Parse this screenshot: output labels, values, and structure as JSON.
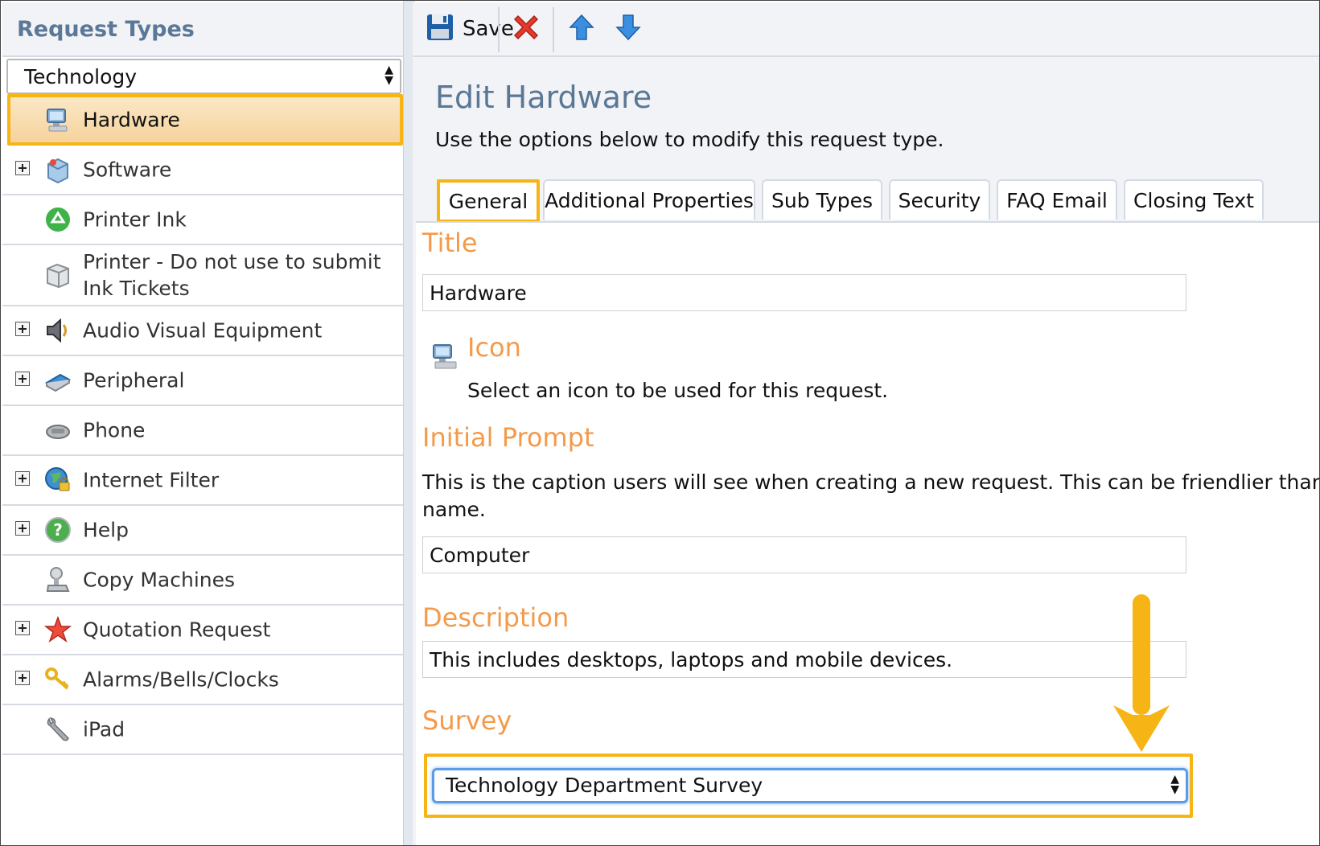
{
  "sidebar": {
    "title": "Request Types",
    "category": "Technology",
    "items": [
      {
        "label": "Hardware",
        "icon": "computer-icon",
        "expandable": false,
        "selected": true
      },
      {
        "label": "Software",
        "icon": "software-box-icon",
        "expandable": true
      },
      {
        "label": "Printer Ink",
        "icon": "recycle-icon",
        "expandable": false
      },
      {
        "label": "Printer - Do not use to submit Ink Tickets",
        "icon": "printer-icon",
        "expandable": false
      },
      {
        "label": "Audio Visual Equipment",
        "icon": "speaker-icon",
        "expandable": true
      },
      {
        "label": "Peripheral",
        "icon": "scanner-icon",
        "expandable": true
      },
      {
        "label": "Phone",
        "icon": "phone-icon",
        "expandable": false
      },
      {
        "label": "Internet Filter",
        "icon": "globe-lock-icon",
        "expandable": true
      },
      {
        "label": "Help",
        "icon": "help-icon",
        "expandable": true
      },
      {
        "label": "Copy Machines",
        "icon": "copier-icon",
        "expandable": false
      },
      {
        "label": "Quotation Request",
        "icon": "star-icon",
        "expandable": true
      },
      {
        "label": "Alarms/Bells/Clocks",
        "icon": "keys-icon",
        "expandable": true
      },
      {
        "label": "iPad",
        "icon": "wrench-icon",
        "expandable": false
      }
    ]
  },
  "toolbar": {
    "save_label": "Save",
    "save_icon": "floppy-disk-icon",
    "delete_icon": "delete-x-icon",
    "move_up_icon": "arrow-up-icon",
    "move_down_icon": "arrow-down-icon"
  },
  "main": {
    "title": "Edit Hardware",
    "subtitle": "Use the options below to modify this request type.",
    "tabs": [
      "General",
      "Additional Properties",
      "Sub Types",
      "Security",
      "FAQ Email",
      "Closing Text"
    ],
    "active_tab": "General"
  },
  "form": {
    "title_heading": "Title",
    "title_value": "Hardware",
    "icon_heading": "Icon",
    "icon_help": "Select an icon to be used for this request.",
    "prompt_heading": "Initial Prompt",
    "prompt_help_line1": "This is the caption users will see when creating a new request. This can be friendlier than the r",
    "prompt_help_line2": "name.",
    "prompt_value": "Computer",
    "description_heading": "Description",
    "description_value": "This includes desktops, laptops and mobile devices.",
    "survey_heading": "Survey",
    "survey_value": "Technology Department Survey"
  },
  "colors": {
    "highlight": "#f7b415",
    "section_heading": "#f49a4a",
    "title_blue": "#5a7896"
  }
}
